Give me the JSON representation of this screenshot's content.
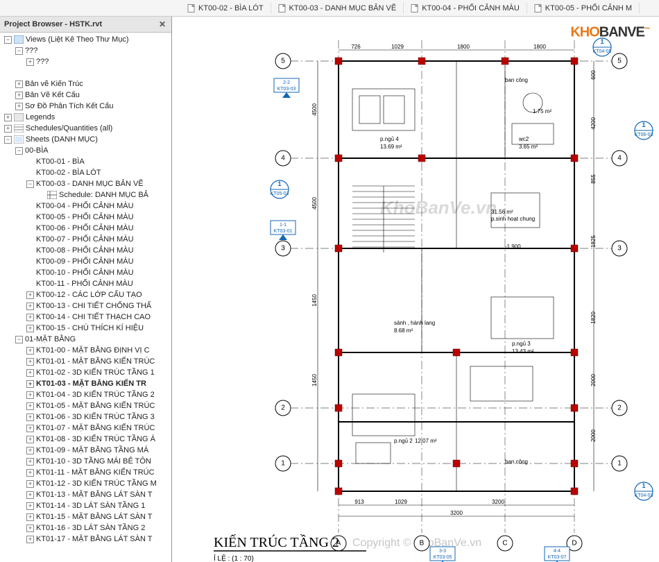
{
  "browser": {
    "title": "Project Browser - HSTK.rvt",
    "tree": [
      {
        "depth": 0,
        "exp": "-",
        "icon": "views",
        "label": "Views (Liệt Kê Theo Thư Mục)"
      },
      {
        "depth": 1,
        "exp": "-",
        "icon": "",
        "label": "???"
      },
      {
        "depth": 2,
        "exp": "+",
        "icon": "",
        "label": "???"
      },
      {
        "depth": 1,
        "exp": "",
        "icon": "",
        "label": ""
      },
      {
        "depth": 1,
        "exp": "+",
        "icon": "",
        "label": "Bản vẽ Kiến Trúc"
      },
      {
        "depth": 1,
        "exp": "+",
        "icon": "",
        "label": "Bản Vẽ Kết Cấu"
      },
      {
        "depth": 1,
        "exp": "+",
        "icon": "",
        "label": "Sơ Đồ Phân Tích Kết Cấu"
      },
      {
        "depth": 0,
        "exp": "+",
        "icon": "legends",
        "label": "Legends"
      },
      {
        "depth": 0,
        "exp": "+",
        "icon": "sched",
        "label": "Schedules/Quantities (all)"
      },
      {
        "depth": 0,
        "exp": "-",
        "icon": "sheets",
        "label": "Sheets (DANH MỤC)"
      },
      {
        "depth": 1,
        "exp": "-",
        "icon": "",
        "label": "00-BÌA"
      },
      {
        "depth": 2,
        "exp": "",
        "icon": "",
        "label": "KT00-01 - BÌA"
      },
      {
        "depth": 2,
        "exp": "",
        "icon": "",
        "label": "KT00-02 - BÌA LÓT"
      },
      {
        "depth": 2,
        "exp": "-",
        "icon": "",
        "label": "KT00-03 - DANH MỤC BẢN VẼ"
      },
      {
        "depth": 3,
        "exp": "",
        "icon": "schedbox",
        "label": "Schedule: DANH MỤC BẢ"
      },
      {
        "depth": 2,
        "exp": "",
        "icon": "",
        "label": "KT00-04 - PHỐI CẢNH MÀU"
      },
      {
        "depth": 2,
        "exp": "",
        "icon": "",
        "label": "KT00-05 - PHỐI CẢNH MÀU"
      },
      {
        "depth": 2,
        "exp": "",
        "icon": "",
        "label": "KT00-06 - PHỐI CẢNH MÀU"
      },
      {
        "depth": 2,
        "exp": "",
        "icon": "",
        "label": "KT00-07 - PHỐI CẢNH MÀU"
      },
      {
        "depth": 2,
        "exp": "",
        "icon": "",
        "label": "KT00-08 - PHỐI CẢNH MÀU"
      },
      {
        "depth": 2,
        "exp": "",
        "icon": "",
        "label": "KT00-09 - PHỐI CẢNH MÀU"
      },
      {
        "depth": 2,
        "exp": "",
        "icon": "",
        "label": "KT00-10 - PHỐI CẢNH MÀU"
      },
      {
        "depth": 2,
        "exp": "",
        "icon": "",
        "label": "KT00-11 - PHỐI CẢNH MÀU"
      },
      {
        "depth": 2,
        "exp": "+",
        "icon": "",
        "label": "KT00-12 - CÁC LỚP CẤU TẠO"
      },
      {
        "depth": 2,
        "exp": "+",
        "icon": "",
        "label": "KT00-13 - CHI TIẾT CHỐNG THẤ"
      },
      {
        "depth": 2,
        "exp": "+",
        "icon": "",
        "label": "KT00-14 - CHI TIẾT THẠCH CAO"
      },
      {
        "depth": 2,
        "exp": "+",
        "icon": "",
        "label": "KT00-15 - CHÚ THÍCH KÍ HIỆU"
      },
      {
        "depth": 1,
        "exp": "-",
        "icon": "",
        "label": "01-MẶT BẰNG"
      },
      {
        "depth": 2,
        "exp": "+",
        "icon": "",
        "label": "KT01-00 - MẶT BẰNG ĐỊNH VỊ C"
      },
      {
        "depth": 2,
        "exp": "+",
        "icon": "",
        "label": "KT01-01 - MẶT BẰNG KIẾN TRÚC"
      },
      {
        "depth": 2,
        "exp": "+",
        "icon": "",
        "label": "KT01-02 - 3D KIẾN TRÚC TẦNG 1"
      },
      {
        "depth": 2,
        "exp": "+",
        "icon": "",
        "label": "KT01-03 - MẶT BẰNG KIẾN TR",
        "bold": true
      },
      {
        "depth": 2,
        "exp": "+",
        "icon": "",
        "label": "KT01-04 - 3D KIẾN TRÚC TẦNG 2"
      },
      {
        "depth": 2,
        "exp": "+",
        "icon": "",
        "label": "KT01-05 - MẶT BẰNG KIẾN TRÚC"
      },
      {
        "depth": 2,
        "exp": "+",
        "icon": "",
        "label": "KT01-06 - 3D KIẾN TRÚC TẦNG 3"
      },
      {
        "depth": 2,
        "exp": "+",
        "icon": "",
        "label": "KT01-07 - MẶT BẰNG KIẾN TRÚC"
      },
      {
        "depth": 2,
        "exp": "+",
        "icon": "",
        "label": "KT01-08 - 3D KIẾN TRÚC TẦNG Á"
      },
      {
        "depth": 2,
        "exp": "+",
        "icon": "",
        "label": "KT01-09 - MẶT BẰNG TẦNG MÁ"
      },
      {
        "depth": 2,
        "exp": "+",
        "icon": "",
        "label": "KT01-10 - 3D TẦNG MÁI BÊ TÔN"
      },
      {
        "depth": 2,
        "exp": "+",
        "icon": "",
        "label": "KT01-11 - MẶT BẰNG KIẾN TRÚC"
      },
      {
        "depth": 2,
        "exp": "+",
        "icon": "",
        "label": "KT01-12 - 3D KIẾN TRÚC TẦNG M"
      },
      {
        "depth": 2,
        "exp": "+",
        "icon": "",
        "label": "KT01-13 - MẶT BẰNG LÁT SÀN T"
      },
      {
        "depth": 2,
        "exp": "+",
        "icon": "",
        "label": "KT01-14 - 3D LÁT SÀN TẦNG 1"
      },
      {
        "depth": 2,
        "exp": "+",
        "icon": "",
        "label": "KT01-15 - MẶT BẰNG LÁT SÀN T"
      },
      {
        "depth": 2,
        "exp": "+",
        "icon": "",
        "label": "KT01-16 - 3D LÁT SÀN TẦNG 2"
      },
      {
        "depth": 2,
        "exp": "+",
        "icon": "",
        "label": "KT01-17 - MẶT BẰNG LÁT SÀN T"
      }
    ]
  },
  "tabs": [
    {
      "label": "KT00-02 - BÌA LÓT"
    },
    {
      "label": "KT00-03 - DANH MỤC BẢN VẼ"
    },
    {
      "label": "KT00-04 - PHỐI CẢNH MÀU"
    },
    {
      "label": "KT00-05 - PHỐI CẢNH M"
    }
  ],
  "drawing": {
    "title_fragment": "KIẾN TRÚC TẦNG 2",
    "scale_label": "Ỉ LỆ : (1 : 70)",
    "grids_h": [
      "1",
      "2",
      "3",
      "4",
      "5"
    ],
    "grids_v": [
      "A",
      "B",
      "C",
      "D"
    ],
    "dims_top": [
      "726",
      "1029",
      "1800",
      "1800"
    ],
    "dims_left": [
      "4500",
      "4500",
      "1450",
      "1450"
    ],
    "dims_right": [
      "600",
      "4200",
      "855",
      "1825",
      "1820",
      "2000",
      "2000"
    ],
    "dims_bottom": [
      "913",
      "1029",
      "3200"
    ],
    "overall_width": "3200",
    "rooms": [
      {
        "name": "p.ngủ 4",
        "area": "13.69 m²"
      },
      {
        "name": "wc2",
        "area": "3.65 m²"
      },
      {
        "name": "p.sinh hoạt chung",
        "area": "31.56 m²"
      },
      {
        "name": "sảnh , hành lang",
        "area": "8.68 m²"
      },
      {
        "name": "p.ngủ 3",
        "area": "13.43 m²"
      },
      {
        "name": "p.ngủ 2",
        "area": "12.07 m²"
      },
      {
        "name": "ban công",
        "area": ""
      },
      {
        "name": "ban công",
        "area": ""
      }
    ],
    "level_marker": "-1.900",
    "wc_extra": "1.75 m²",
    "callouts": [
      {
        "tag": "2-2",
        "ref": "KT03-03"
      },
      {
        "tag": "1",
        "ref": "KT05-03"
      },
      {
        "tag": "1-1",
        "ref": "KT03-01"
      },
      {
        "tag": "1",
        "ref": "KT04-05"
      },
      {
        "tag": "1",
        "ref": "KT06-03"
      },
      {
        "tag": "1",
        "ref": "KT04-03"
      },
      {
        "tag": "3-3",
        "ref": "KT03-05"
      },
      {
        "tag": "4-4",
        "ref": "KT03-07"
      }
    ]
  },
  "watermarks": {
    "logo_part1": "KHO",
    "logo_part2": "BANVE",
    "center": "KhoBanVe.vn",
    "bottom": "Copyright © KhoBanVe.vn"
  }
}
